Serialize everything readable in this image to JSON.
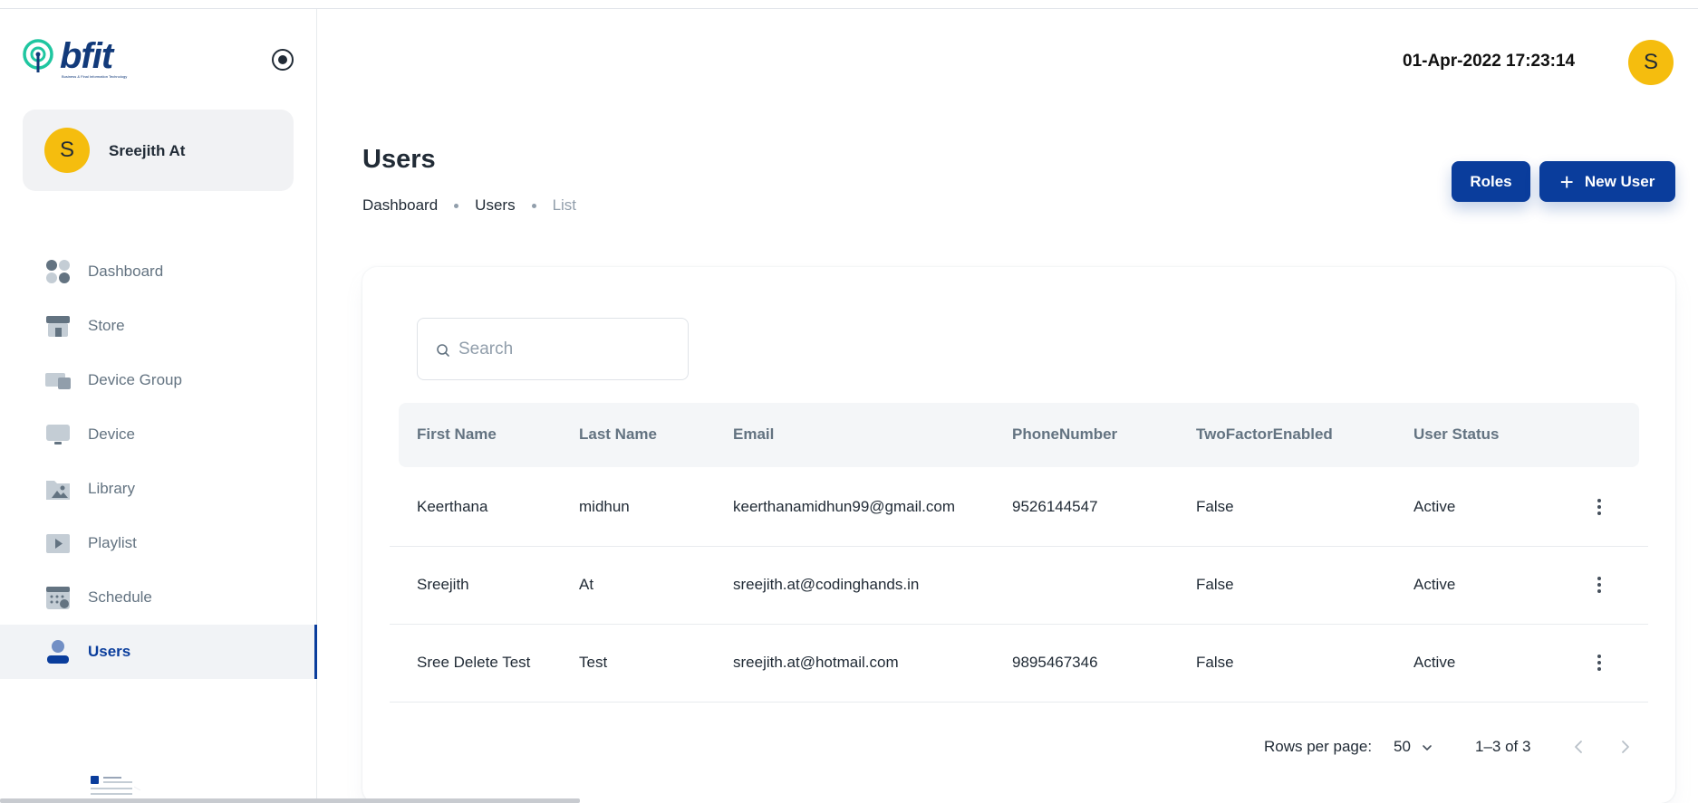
{
  "app": {
    "logo_text": "bfit",
    "logo_subtitle": "Business & Final Information Technology",
    "datetime": "01-Apr-2022 17:23:14",
    "header_avatar_initial": "S"
  },
  "account": {
    "initial": "S",
    "name": "Sreejith At"
  },
  "sidebar": {
    "items": [
      {
        "label": "Dashboard",
        "icon": "dashboard-icon"
      },
      {
        "label": "Store",
        "icon": "store-icon"
      },
      {
        "label": "Device Group",
        "icon": "device-group-icon"
      },
      {
        "label": "Device",
        "icon": "monitor-icon"
      },
      {
        "label": "Library",
        "icon": "folder-image-icon"
      },
      {
        "label": "Playlist",
        "icon": "play-icon"
      },
      {
        "label": "Schedule",
        "icon": "calendar-icon"
      },
      {
        "label": "Users",
        "icon": "user-icon",
        "active": true
      }
    ]
  },
  "page": {
    "title": "Users",
    "breadcrumb": [
      "Dashboard",
      "Users",
      "List"
    ]
  },
  "actions": {
    "roles_label": "Roles",
    "new_user_label": "New User"
  },
  "search": {
    "placeholder": "Search",
    "value": ""
  },
  "table": {
    "columns": [
      "First Name",
      "Last Name",
      "Email",
      "PhoneNumber",
      "TwoFactorEnabled",
      "User Status"
    ],
    "rows": [
      [
        "Keerthana",
        "midhun",
        "keerthanamidhun99@gmail.com",
        "9526144547",
        "False",
        "Active"
      ],
      [
        "Sreejith",
        "At",
        "sreejith.at@codinghands.in",
        "",
        "False",
        "Active"
      ],
      [
        "Sree Delete Test",
        "Test",
        "sreejith.at@hotmail.com",
        "9895467346",
        "False",
        "Active"
      ]
    ]
  },
  "pagination": {
    "rows_per_page_label": "Rows per page:",
    "rows_per_page": "50",
    "range": "1–3 of 3"
  },
  "colors": {
    "primary": "#0a3d9c",
    "avatar": "#f5bd0e",
    "logo_accent": "#1fc6a0",
    "text_secondary": "#637381"
  }
}
